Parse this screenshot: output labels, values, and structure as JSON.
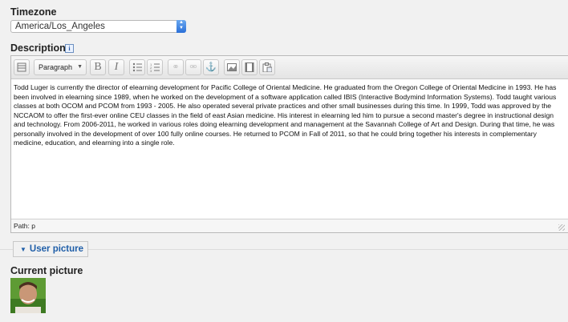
{
  "timezone": {
    "label": "Timezone",
    "value": "America/Los_Angeles"
  },
  "description": {
    "label": "Description",
    "format_value": "Paragraph",
    "text": "Todd Luger is currently the director of elearning development for Pacific College of Oriental Medicine. He graduated from the Oregon College of Oriental Medicine in 1993. He has been involved in elearning since 1989, when he worked on the development of a software application called IBIS (Interactive Bodymind Information Systems). Todd taught various classes at both OCOM and PCOM from 1993 - 2005. He also operated several private practices and other small businesses during this time. In 1999, Todd was approved by the NCCAOM to offer the first-ever online CEU classes in the field of east Asian medicine. His interest in elearning led him to pursue a second master's degree in instructional design and technology. From 2006-2011, he worked in various roles doing elearning development and management at the Savannah College of Art and Design. During that time, he was personally involved in the development of over 100 fully online courses. He returned to PCOM in Fall of 2011, so that he could bring together his interests in complementary medicine, education, and elearning into a single role.",
    "path": "Path: p"
  },
  "user_picture": {
    "legend": "User picture",
    "current_label": "Current picture"
  },
  "icons": {
    "toolbar": [
      "toggle-toolbar-icon",
      "bold-icon",
      "italic-icon",
      "unordered-list-icon",
      "ordered-list-icon",
      "link-icon",
      "unlink-icon",
      "anchor-icon",
      "image-icon",
      "media-icon",
      "paste-word-icon"
    ]
  }
}
